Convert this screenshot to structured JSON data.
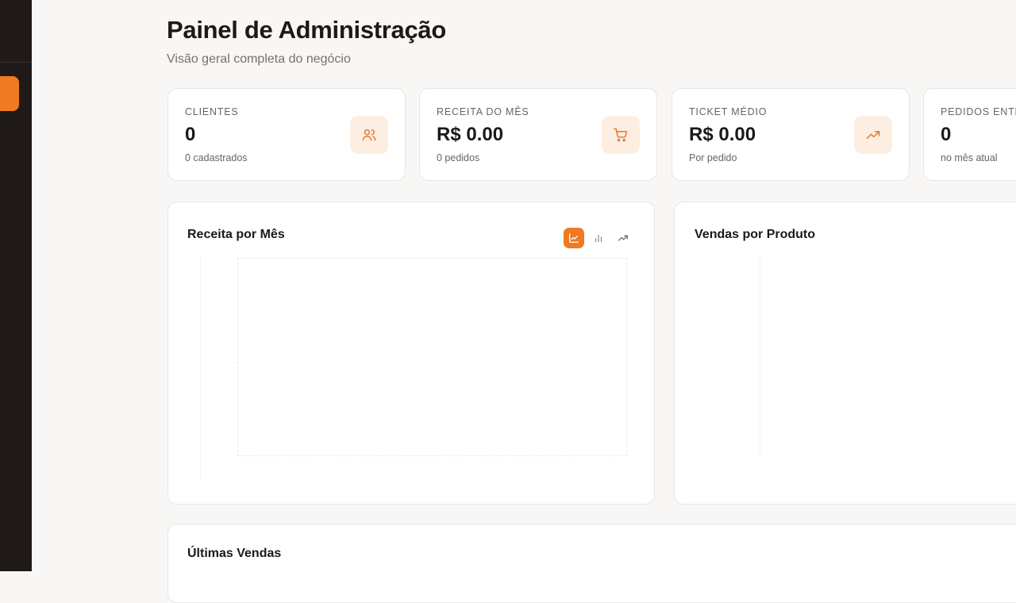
{
  "page": {
    "title": "Painel de Administração",
    "subtitle": "Visão geral completa do negócio"
  },
  "stats": [
    {
      "label": "CLIENTES",
      "value": "0",
      "sub": "0 cadastrados",
      "icon": "users-icon"
    },
    {
      "label": "RECEITA DO MÊS",
      "value": "R$ 0.00",
      "sub": "0 pedidos",
      "icon": "shopping-cart-icon"
    },
    {
      "label": "TICKET MÉDIO",
      "value": "R$ 0.00",
      "sub": "Por pedido",
      "icon": "trending-up-icon"
    },
    {
      "label": "PEDIDOS ENTR",
      "value": "0",
      "sub": "no mês atual",
      "icon": ""
    }
  ],
  "revenue_chart": {
    "title": "Receita por Mês",
    "toggles": [
      "area-chart-icon",
      "bar-chart-icon",
      "line-chart-icon"
    ],
    "active_toggle": "area-chart-icon"
  },
  "products_chart": {
    "title": "Vendas por Produto"
  },
  "recent_sales": {
    "title": "Últimas Vendas"
  },
  "colors": {
    "accent": "#ef7a22",
    "accent_soft": "#fdeee2",
    "sidebar": "#1f1a17",
    "background": "#f8f7f5"
  }
}
